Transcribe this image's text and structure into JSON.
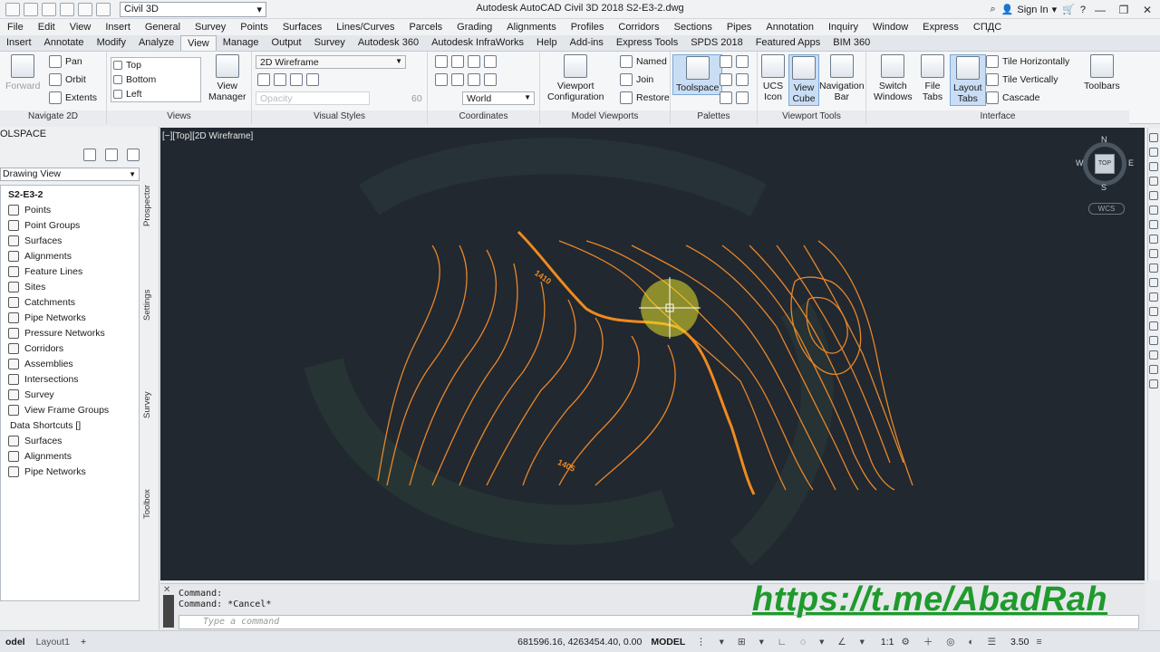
{
  "app": {
    "title": "Autodesk AutoCAD Civil 3D 2018   S2-E3-2.dwg",
    "workspace": "Civil 3D",
    "sign_in": "Sign In"
  },
  "menu": [
    "File",
    "Edit",
    "View",
    "Insert",
    "General",
    "Survey",
    "Points",
    "Surfaces",
    "Lines/Curves",
    "Parcels",
    "Grading",
    "Alignments",
    "Profiles",
    "Corridors",
    "Sections",
    "Pipes",
    "Annotation",
    "Inquiry",
    "Window",
    "Express",
    "СПДС"
  ],
  "tabs": [
    "Insert",
    "Annotate",
    "Modify",
    "Analyze",
    "View",
    "Manage",
    "Output",
    "Survey",
    "Autodesk 360",
    "Autodesk InfraWorks",
    "Help",
    "Add-ins",
    "Express Tools",
    "SPDS 2018",
    "Featured Apps",
    "BIM 360"
  ],
  "active_tab": "View",
  "ribbon": {
    "navigate": {
      "forward": "Forward",
      "pan": "Pan",
      "orbit": "Orbit",
      "extents": "Extents",
      "title": "Navigate 2D"
    },
    "views": {
      "top": "Top",
      "bottom": "Bottom",
      "left": "Left",
      "manager": "View\nManager",
      "title": "Views"
    },
    "visual_styles": {
      "current": "2D Wireframe",
      "opacity_label": "Opacity",
      "opacity_value": "60",
      "title": "Visual Styles"
    },
    "coordinates": {
      "world": "World",
      "title": "Coordinates"
    },
    "model_viewports": {
      "config": "Viewport\nConfiguration",
      "named": "Named",
      "join": "Join",
      "restore": "Restore",
      "title": "Model Viewports"
    },
    "palettes": {
      "toolspace": "Toolspace",
      "title": "Palettes"
    },
    "viewport_tools": {
      "ucs": "UCS\nIcon",
      "viewcube": "View\nCube",
      "navbar": "Navigation\nBar",
      "title": "Viewport Tools"
    },
    "interface": {
      "switch": "Switch\nWindows",
      "file_tabs": "File\nTabs",
      "layout_tabs": "Layout\nTabs",
      "tile_h": "Tile Horizontally",
      "tile_v": "Tile Vertically",
      "cascade": "Cascade",
      "toolbars": "Toolbars",
      "title": "Interface"
    }
  },
  "toolspace": {
    "title": "OLSPACE",
    "view_dropdown": "Drawing View",
    "root": "S2-E3-2",
    "items": [
      "Points",
      "Point Groups",
      "Surfaces",
      "Alignments",
      "Feature Lines",
      "Sites",
      "Catchments",
      "Pipe Networks",
      "Pressure Networks",
      "Corridors",
      "Assemblies",
      "Intersections",
      "Survey",
      "View Frame Groups"
    ],
    "data_shortcuts": "Data Shortcuts []",
    "shortcut_items": [
      "Surfaces",
      "Alignments",
      "Pipe Networks"
    ],
    "side_tabs": [
      "Prospector",
      "Settings",
      "Survey",
      "Toolbox"
    ]
  },
  "viewport": {
    "label": "[−][Top][2D Wireframe]",
    "compass": {
      "n": "N",
      "s": "S",
      "e": "E",
      "w": "W",
      "top": "TOP"
    },
    "wcs": "WCS",
    "contour_labels": [
      "1410",
      "1405"
    ],
    "colors": {
      "background": "#212830",
      "contour": "#e8862a",
      "index_contour": "#f08a1e",
      "highlight": "#e5e02a"
    }
  },
  "command": {
    "line1": "Command:",
    "line2": "Command: *Cancel*",
    "placeholder": "Type a command"
  },
  "overlay_link": "https://t.me/AbadRah",
  "status": {
    "model_tab": "odel",
    "layout_tab": "Layout1",
    "coords": "681596.16, 4263454.40, 0.00",
    "model": "MODEL",
    "scale": "1:1",
    "value": "3.50"
  }
}
